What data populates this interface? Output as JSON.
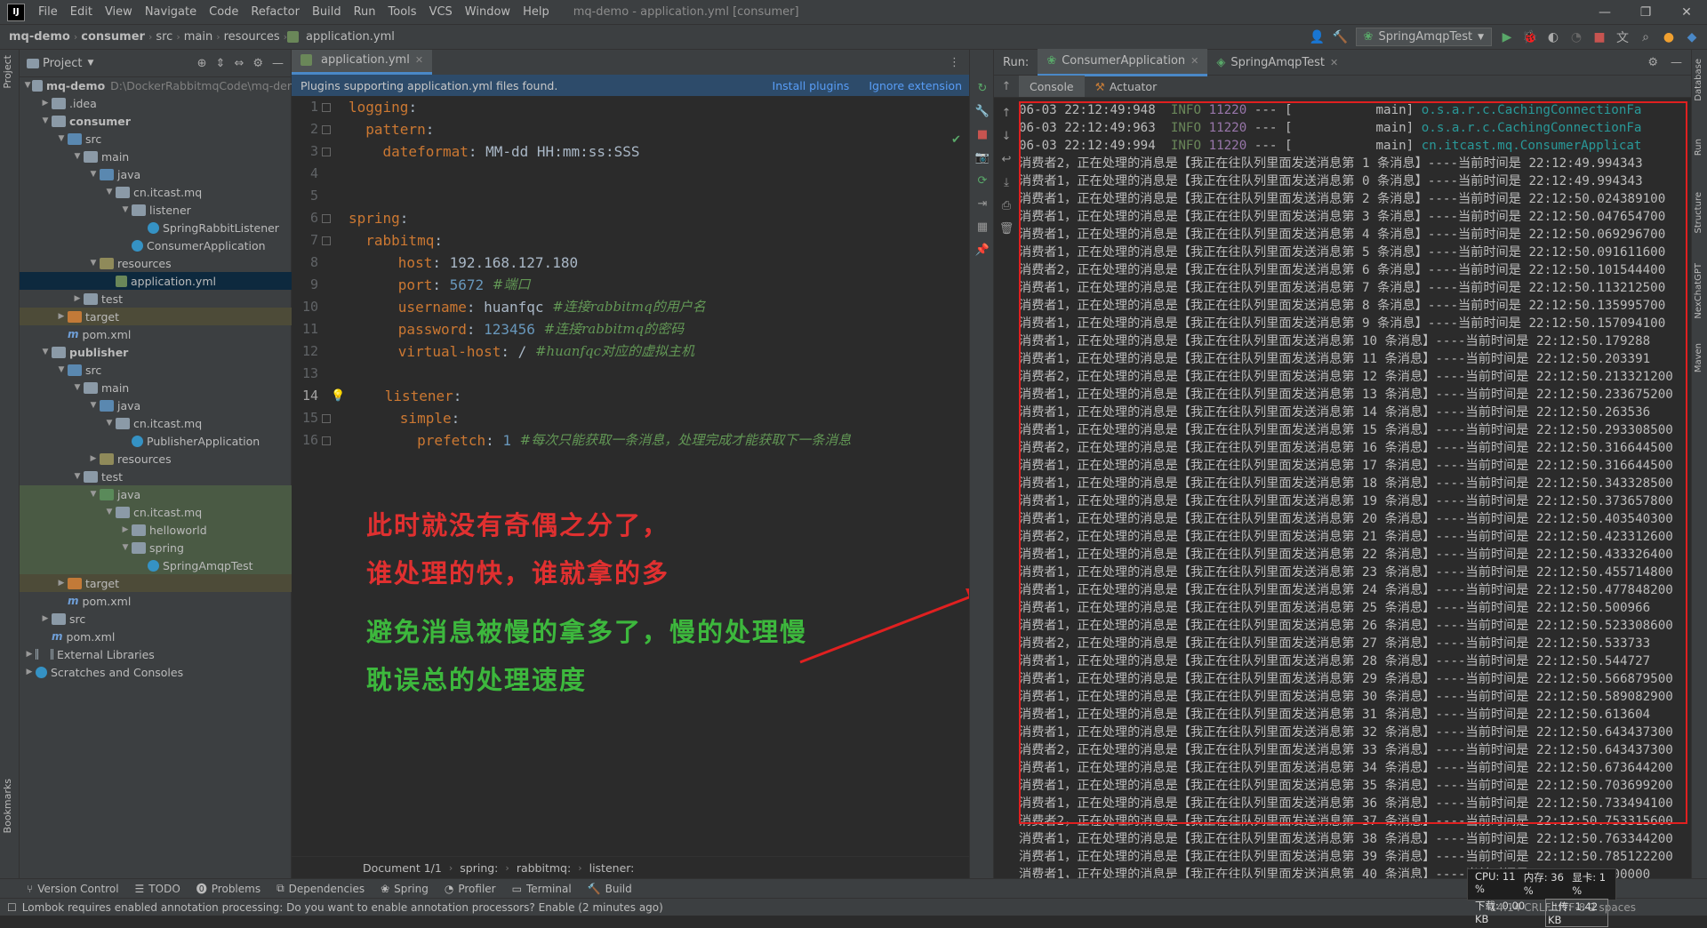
{
  "menu": {
    "items": [
      "File",
      "Edit",
      "View",
      "Navigate",
      "Code",
      "Refactor",
      "Build",
      "Run",
      "Tools",
      "VCS",
      "Window",
      "Help"
    ],
    "window_title": "mq-demo - application.yml [consumer]"
  },
  "nav": {
    "crumbs": [
      "mq-demo",
      "consumer",
      "src",
      "main",
      "resources",
      "application.yml"
    ],
    "run_config": "SpringAmqpTest"
  },
  "project": {
    "header": "Project",
    "root_path": "D:\\DockerRabbitmqCode\\mq-der",
    "tree": [
      {
        "label": "mq-demo",
        "bold": true
      },
      {
        "label": ".idea"
      },
      {
        "label": "consumer",
        "bold": true
      },
      {
        "label": "src"
      },
      {
        "label": "main"
      },
      {
        "label": "java"
      },
      {
        "label": "cn.itcast.mq"
      },
      {
        "label": "listener"
      },
      {
        "label": "SpringRabbitListener"
      },
      {
        "label": "ConsumerApplication"
      },
      {
        "label": "resources"
      },
      {
        "label": "application.yml"
      },
      {
        "label": "test"
      },
      {
        "label": "target"
      },
      {
        "label": "pom.xml"
      },
      {
        "label": "publisher",
        "bold": true
      },
      {
        "label": "src"
      },
      {
        "label": "main"
      },
      {
        "label": "java"
      },
      {
        "label": "cn.itcast.mq"
      },
      {
        "label": "PublisherApplication"
      },
      {
        "label": "resources"
      },
      {
        "label": "test"
      },
      {
        "label": "java"
      },
      {
        "label": "cn.itcast.mq"
      },
      {
        "label": "helloworld"
      },
      {
        "label": "spring"
      },
      {
        "label": "SpringAmqpTest"
      },
      {
        "label": "target"
      },
      {
        "label": "pom.xml"
      },
      {
        "label": "src"
      },
      {
        "label": "pom.xml"
      },
      {
        "label": "External Libraries"
      },
      {
        "label": "Scratches and Consoles"
      }
    ]
  },
  "editor": {
    "tab": "application.yml",
    "notice": "Plugins supporting application.yml files found.",
    "install": "Install plugins",
    "ignore": "Ignore extension",
    "lines": [
      {
        "n": "1",
        "key": "logging",
        "val": "",
        "comment": ""
      },
      {
        "n": "2",
        "key": "pattern",
        "val": "",
        "comment": ""
      },
      {
        "n": "3",
        "key": "dateformat",
        "val": "MM-dd HH:mm:ss:SSS",
        "comment": ""
      },
      {
        "n": "4",
        "key": "",
        "val": "",
        "comment": ""
      },
      {
        "n": "5",
        "key": "",
        "val": "",
        "comment": ""
      },
      {
        "n": "6",
        "key": "spring",
        "val": "",
        "comment": ""
      },
      {
        "n": "7",
        "key": "rabbitmq",
        "val": "",
        "comment": ""
      },
      {
        "n": "8",
        "key": "host",
        "val": "192.168.127.180",
        "comment": ""
      },
      {
        "n": "9",
        "key": "port",
        "val": "5672",
        "comment": "#端口"
      },
      {
        "n": "10",
        "key": "username",
        "val": "huanfqc",
        "comment": "#连接rabbitmq的用户名"
      },
      {
        "n": "11",
        "key": "password",
        "val": "123456",
        "comment": "#连接rabbitmq的密码"
      },
      {
        "n": "12",
        "key": "virtual-host",
        "val": "/",
        "comment": "#huanfqc对应的虚拟主机"
      },
      {
        "n": "13",
        "key": "",
        "val": "",
        "comment": ""
      },
      {
        "n": "14",
        "key": "listener",
        "val": "",
        "comment": ""
      },
      {
        "n": "15",
        "key": "simple",
        "val": "",
        "comment": ""
      },
      {
        "n": "16",
        "key": "prefetch",
        "val": "1",
        "comment": "#每次只能获取一条消息，处理完成才能获取下一条消息"
      }
    ],
    "breadcrumbs": [
      "Document 1/1",
      "spring:",
      "rabbitmq:",
      "listener:"
    ],
    "annotation_red_1": "此时就没有奇偶之分了，",
    "annotation_red_2": "谁处理的快，谁就拿的多",
    "annotation_green_1": "避免消息被慢的拿多了，慢的处理慢",
    "annotation_green_2": "耽误总的处理速度"
  },
  "run": {
    "label": "Run:",
    "tabs": [
      "ConsumerApplication",
      "SpringAmqpTest"
    ],
    "subtabs": [
      "Console",
      "Actuator"
    ],
    "log_lines": [
      {
        "time": "06-03 22:12:49:948",
        "level": "INFO",
        "pid": "11220",
        "thread": "main",
        "logger": "o.s.a.r.c.CachingConnectionFa"
      },
      {
        "time": "06-03 22:12:49:963",
        "level": "INFO",
        "pid": "11220",
        "thread": "main",
        "logger": "o.s.a.r.c.CachingConnectionFa"
      },
      {
        "time": "06-03 22:12:49:994",
        "level": "INFO",
        "pid": "11220",
        "thread": "main",
        "logger": "cn.itcast.mq.ConsumerApplicat"
      }
    ],
    "messages": [
      {
        "c": "2",
        "n": "1",
        "t": "22:12:49.994343"
      },
      {
        "c": "1",
        "n": "0",
        "t": "22:12:49.994343"
      },
      {
        "c": "1",
        "n": "2",
        "t": "22:12:50.024389100"
      },
      {
        "c": "1",
        "n": "3",
        "t": "22:12:50.047654700"
      },
      {
        "c": "1",
        "n": "4",
        "t": "22:12:50.069296700"
      },
      {
        "c": "1",
        "n": "5",
        "t": "22:12:50.091611600"
      },
      {
        "c": "2",
        "n": "6",
        "t": "22:12:50.101544400"
      },
      {
        "c": "1",
        "n": "7",
        "t": "22:12:50.113212500"
      },
      {
        "c": "1",
        "n": "8",
        "t": "22:12:50.135995700"
      },
      {
        "c": "1",
        "n": "9",
        "t": "22:12:50.157094100"
      },
      {
        "c": "1",
        "n": "10",
        "t": "22:12:50.179288"
      },
      {
        "c": "1",
        "n": "11",
        "t": "22:12:50.203391"
      },
      {
        "c": "2",
        "n": "12",
        "t": "22:12:50.213321200"
      },
      {
        "c": "1",
        "n": "13",
        "t": "22:12:50.233675200"
      },
      {
        "c": "1",
        "n": "14",
        "t": "22:12:50.263536"
      },
      {
        "c": "1",
        "n": "15",
        "t": "22:12:50.293308500"
      },
      {
        "c": "2",
        "n": "16",
        "t": "22:12:50.316644500"
      },
      {
        "c": "1",
        "n": "17",
        "t": "22:12:50.316644500"
      },
      {
        "c": "1",
        "n": "18",
        "t": "22:12:50.343328500"
      },
      {
        "c": "1",
        "n": "19",
        "t": "22:12:50.373657800"
      },
      {
        "c": "1",
        "n": "20",
        "t": "22:12:50.403540300"
      },
      {
        "c": "2",
        "n": "21",
        "t": "22:12:50.423312600"
      },
      {
        "c": "1",
        "n": "22",
        "t": "22:12:50.433326400"
      },
      {
        "c": "1",
        "n": "23",
        "t": "22:12:50.455714800"
      },
      {
        "c": "1",
        "n": "24",
        "t": "22:12:50.477848200"
      },
      {
        "c": "1",
        "n": "25",
        "t": "22:12:50.500966"
      },
      {
        "c": "1",
        "n": "26",
        "t": "22:12:50.523308600"
      },
      {
        "c": "2",
        "n": "27",
        "t": "22:12:50.533733"
      },
      {
        "c": "1",
        "n": "28",
        "t": "22:12:50.544727"
      },
      {
        "c": "1",
        "n": "29",
        "t": "22:12:50.566879500"
      },
      {
        "c": "1",
        "n": "30",
        "t": "22:12:50.589082900"
      },
      {
        "c": "1",
        "n": "31",
        "t": "22:12:50.613604"
      },
      {
        "c": "1",
        "n": "32",
        "t": "22:12:50.643437300"
      },
      {
        "c": "2",
        "n": "33",
        "t": "22:12:50.643437300"
      },
      {
        "c": "1",
        "n": "34",
        "t": "22:12:50.673644200"
      },
      {
        "c": "1",
        "n": "35",
        "t": "22:12:50.703699200"
      },
      {
        "c": "1",
        "n": "36",
        "t": "22:12:50.733494100"
      },
      {
        "c": "2",
        "n": "37",
        "t": "22:12:50.753315600"
      },
      {
        "c": "1",
        "n": "38",
        "t": "22:12:50.763344200"
      },
      {
        "c": "1",
        "n": "39",
        "t": "22:12:50.785122200"
      },
      {
        "c": "1",
        "n": "40",
        "t": "22:12:50.800000"
      }
    ],
    "msg_prefix": "消费者",
    "msg_mid": "，正在处理的消息是【我正在往队列里面发送消息第 ",
    "msg_suffix": " 条消息】----当前时间是 "
  },
  "bottom_tools": [
    "Version Control",
    "TODO",
    "Problems",
    "Dependencies",
    "Spring",
    "Profiler",
    "Terminal",
    "Build"
  ],
  "status": {
    "message": "Lombok requires enabled annotation processing: Do you want to enable annotation processors? Enable (2 minutes ago)",
    "right": "14:14  CRLF  UTF-8  2 spaces"
  },
  "net": {
    "cpu": "CPU: 11 %",
    "mem": "内存: 36 %",
    "gpu": "显卡: 1 %",
    "down": "下载: 0.00 KB",
    "up": "上传: 1.42 KB"
  },
  "colors": {
    "accent": "#4a88c7",
    "annotation_red": "#e03030",
    "annotation_green": "#3db83d",
    "highlight_box": "#e02020"
  }
}
